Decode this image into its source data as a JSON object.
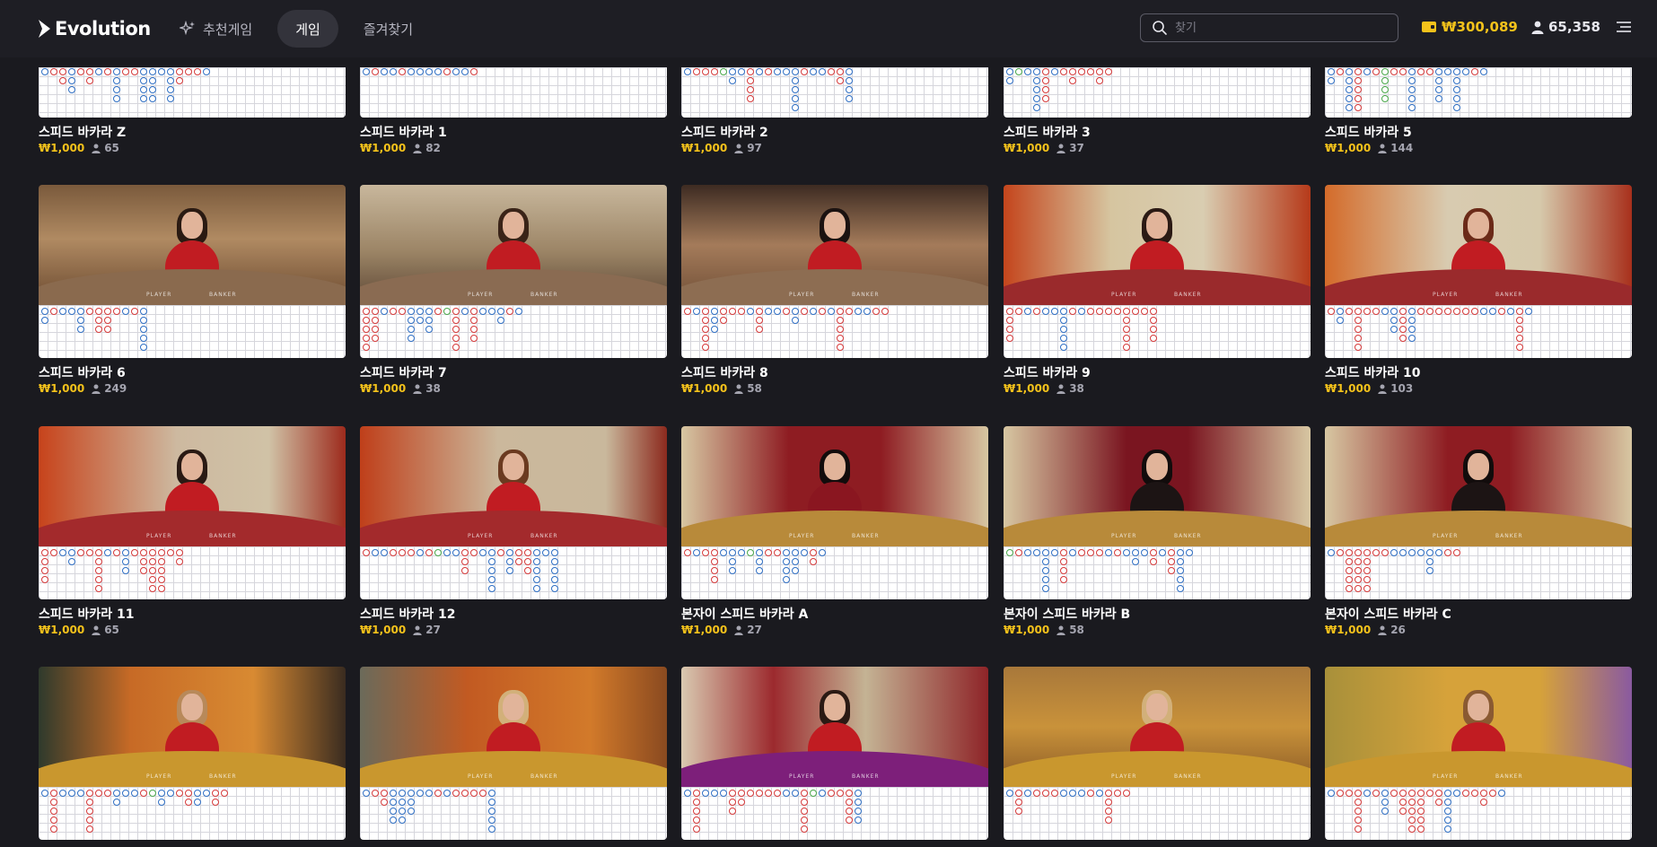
{
  "header": {
    "logo_text": "Evolution",
    "nav": [
      {
        "label": "추천게임",
        "icon": "sparkle-icon",
        "active": false
      },
      {
        "label": "게임",
        "icon": "",
        "active": true
      },
      {
        "label": "즐겨찾기",
        "icon": "",
        "active": false
      }
    ],
    "search_placeholder": "찾기",
    "balance": "₩300,089",
    "players_online": "65,358"
  },
  "colors": {
    "accent": "#f4c21b",
    "background": "#1a1a1f",
    "banker": "#d63a3a",
    "player": "#2f6fc4",
    "tie": "#4aa84a"
  },
  "games": [
    {
      "title": "스피드 바카라 Z",
      "bet": "₩1,000",
      "players": "65"
    },
    {
      "title": "스피드 바카라 1",
      "bet": "₩1,000",
      "players": "82"
    },
    {
      "title": "스피드 바카라 2",
      "bet": "₩1,000",
      "players": "97"
    },
    {
      "title": "스피드 바카라 3",
      "bet": "₩1,000",
      "players": "37"
    },
    {
      "title": "스피드 바카라 5",
      "bet": "₩1,000",
      "players": "144"
    },
    {
      "title": "스피드 바카라 6",
      "bet": "₩1,000",
      "players": "249"
    },
    {
      "title": "스피드 바카라 7",
      "bet": "₩1,000",
      "players": "38"
    },
    {
      "title": "스피드 바카라 8",
      "bet": "₩1,000",
      "players": "58"
    },
    {
      "title": "스피드 바카라 9",
      "bet": "₩1,000",
      "players": "38"
    },
    {
      "title": "스피드 바카라 10",
      "bet": "₩1,000",
      "players": "103"
    },
    {
      "title": "스피드 바카라 11",
      "bet": "₩1,000",
      "players": "65"
    },
    {
      "title": "스피드 바카라 12",
      "bet": "₩1,000",
      "players": "27"
    },
    {
      "title": "본자이 스피드 바카라 A",
      "bet": "₩1,000",
      "players": "27"
    },
    {
      "title": "본자이 스피드 바카라 B",
      "bet": "₩1,000",
      "players": "58"
    },
    {
      "title": "본자이 스피드 바카라 C",
      "bet": "₩1,000",
      "players": "26"
    },
    {
      "title": "",
      "bet": "",
      "players": ""
    },
    {
      "title": "",
      "bet": "",
      "players": ""
    },
    {
      "title": "",
      "bet": "",
      "players": ""
    },
    {
      "title": "",
      "bet": "",
      "players": ""
    },
    {
      "title": "",
      "bet": "",
      "players": ""
    }
  ],
  "table_text": {
    "player": "PLAYER",
    "banker": "BANKER"
  }
}
